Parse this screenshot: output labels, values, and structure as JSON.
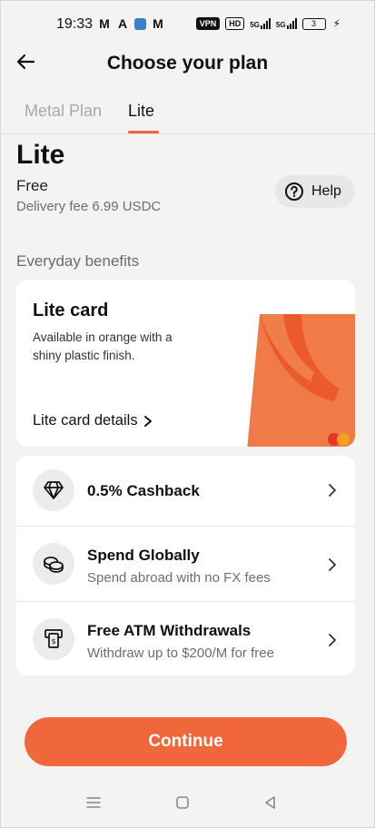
{
  "status_bar": {
    "time": "19:33",
    "app_icons": [
      "M",
      "A",
      "",
      "M"
    ],
    "vpn": "VPN",
    "hd": "HD",
    "net1": "5G",
    "net2": "5G",
    "battery": "3"
  },
  "header": {
    "title": "Choose your plan",
    "back_icon": "arrow-left-icon"
  },
  "tabs": [
    {
      "label": "Metal Plan",
      "active": false
    },
    {
      "label": "Lite",
      "active": true
    }
  ],
  "plan": {
    "name": "Lite",
    "price": "Free",
    "delivery_fee": "Delivery fee 6.99 USDC",
    "help_label": "Help"
  },
  "section_title": "Everyday benefits",
  "card": {
    "title": "Lite card",
    "description": "Available in orange with a shiny plastic finish.",
    "link_label": "Lite card details"
  },
  "benefits": [
    {
      "icon": "diamond-icon",
      "title": "0.5% Cashback",
      "subtitle": ""
    },
    {
      "icon": "coins-icon",
      "title": "Spend Globally",
      "subtitle": "Spend abroad with no FX fees"
    },
    {
      "icon": "atm-icon",
      "title": "Free ATM Withdrawals",
      "subtitle": "Withdraw up to $200/M for free"
    }
  ],
  "continue_label": "Continue",
  "colors": {
    "accent": "#f0673c",
    "background": "#f4f3f2",
    "card_orange": "#f07a48"
  }
}
